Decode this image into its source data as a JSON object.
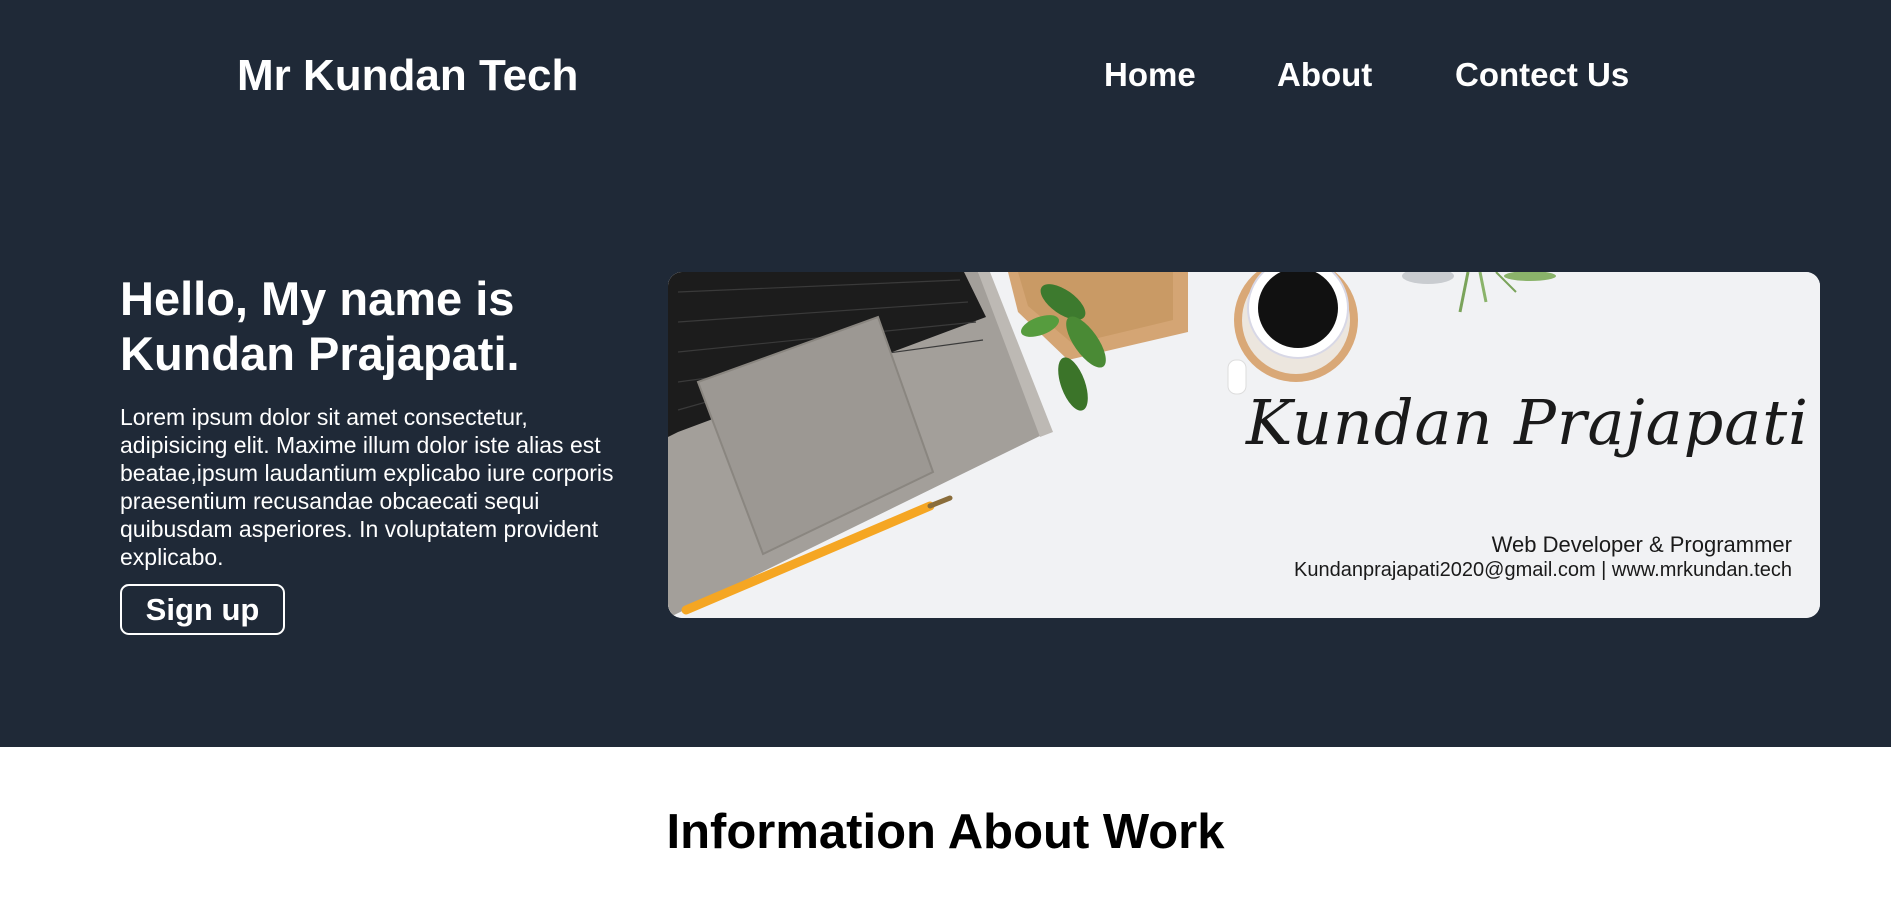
{
  "header": {
    "brand": "Mr Kundan Tech",
    "nav": [
      "Home",
      "About",
      "Contect Us"
    ]
  },
  "hero": {
    "headline": "Hello, My name is Kundan Prajapati.",
    "intro": "Lorem ipsum dolor sit amet consectetur, adipisicing elit. Maxime illum dolor iste alias est beatae,ipsum laudantium explicabo iure corporis praesentium recusandae obcaecati sequi quibusdam asperiores. In voluptatem provident explicabo.",
    "signup_label": "Sign up"
  },
  "banner": {
    "signature": "Kundan Prajapati",
    "role": "Web Developer & Programmer",
    "email": "Kundanprajapati2020@gmail.com",
    "website": "www.mrkundan.tech",
    "contact_line": "Kundanprajapati2020@gmail.com  | www.mrkundan.tech"
  },
  "section": {
    "title": "Information About Work"
  },
  "colors": {
    "hero_background": "#1f2937",
    "text_light": "#ffffff",
    "page_background": "#ffffff"
  }
}
